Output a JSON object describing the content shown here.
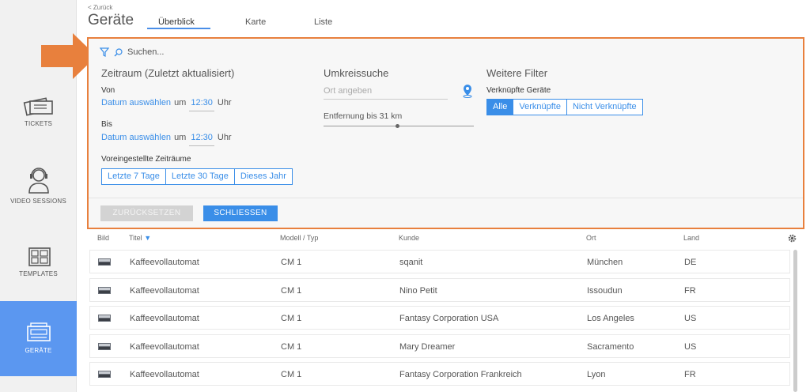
{
  "sidebar": {
    "items": [
      {
        "label": "TICKETS",
        "icon": "ticket-icon"
      },
      {
        "label": "VIDEO SESSIONS",
        "icon": "headset-user-icon"
      },
      {
        "label": "TEMPLATES",
        "icon": "template-icon"
      },
      {
        "label": "GERÄTE",
        "icon": "device-icon",
        "active": true
      }
    ]
  },
  "header": {
    "back": "< Zurück",
    "title": "Geräte",
    "tabs": [
      "Überblick",
      "Karte",
      "Liste"
    ],
    "active_tab": "Überblick"
  },
  "filter": {
    "search_placeholder": "Suchen...",
    "period_title": "Zeitraum (Zuletzt aktualisiert)",
    "from_label": "Von",
    "to_label": "Bis",
    "date_link": "Datum auswählen",
    "at": "um",
    "from_time": "12:30",
    "to_time": "12:30",
    "uhr": "Uhr",
    "preset_label": "Voreingestellte Zeiträume",
    "presets": [
      "Letzte 7 Tage",
      "Letzte 30 Tage",
      "Dieses Jahr"
    ],
    "radius_title": "Umkreissuche",
    "place_placeholder": "Ort angeben",
    "distance_label": "Entfernung bis 31 km",
    "distance_fraction": 0.49,
    "more_title": "Weitere Filter",
    "linked_label": "Verknüpfte Geräte",
    "linked_options": [
      "Alle",
      "Verknüpfte",
      "Nicht Verknüpfte"
    ],
    "linked_selected": "Alle",
    "reset": "ZURÜCKSETZEN",
    "close": "SCHLIESSEN"
  },
  "table": {
    "headers": {
      "image": "Bild",
      "title": "Titel",
      "model": "Modell / Typ",
      "customer": "Kunde",
      "city": "Ort",
      "country": "Land"
    },
    "rows": [
      {
        "title": "Kaffeevollautomat",
        "model": "CM 1",
        "customer": "sqanit",
        "city": "München",
        "country": "DE"
      },
      {
        "title": "Kaffeevollautomat",
        "model": "CM 1",
        "customer": "Nino Petit",
        "city": "Issoudun",
        "country": "FR"
      },
      {
        "title": "Kaffeevollautomat",
        "model": "CM 1",
        "customer": "Fantasy Corporation USA",
        "city": "Los Angeles",
        "country": "US"
      },
      {
        "title": "Kaffeevollautomat",
        "model": "CM 1",
        "customer": "Mary Dreamer",
        "city": "Sacramento",
        "country": "US"
      },
      {
        "title": "Kaffeevollautomat",
        "model": "CM 1",
        "customer": "Fantasy Corporation Frankreich",
        "city": "Lyon",
        "country": "FR"
      }
    ]
  },
  "colors": {
    "accent": "#3a8ee8",
    "highlight": "#e8803d",
    "sidebar_active": "#5b97f0"
  }
}
